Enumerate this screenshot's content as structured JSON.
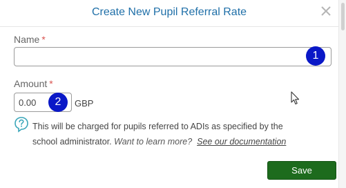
{
  "dialog": {
    "title": "Create New Pupil Referral Rate",
    "close_glyph": "×"
  },
  "form": {
    "name": {
      "label": "Name",
      "required_mark": "*",
      "value": "",
      "placeholder": ""
    },
    "amount": {
      "label": "Amount",
      "required_mark": "*",
      "value": "0.00",
      "currency": "GBP"
    }
  },
  "annotations": {
    "badge_1": "1",
    "badge_2": "2",
    "badge_color": "#0a18c7"
  },
  "help": {
    "icon": "question-circle-icon",
    "text": "This will be charged for pupils referred to ADIs as specified by the school administrator.",
    "learn_more": "Want to learn more?",
    "link": "See our documentation"
  },
  "footer": {
    "save_label": "Save",
    "save_color": "#1d6b1d"
  },
  "colors": {
    "title": "#1f6fa8",
    "required": "#d9534f"
  }
}
